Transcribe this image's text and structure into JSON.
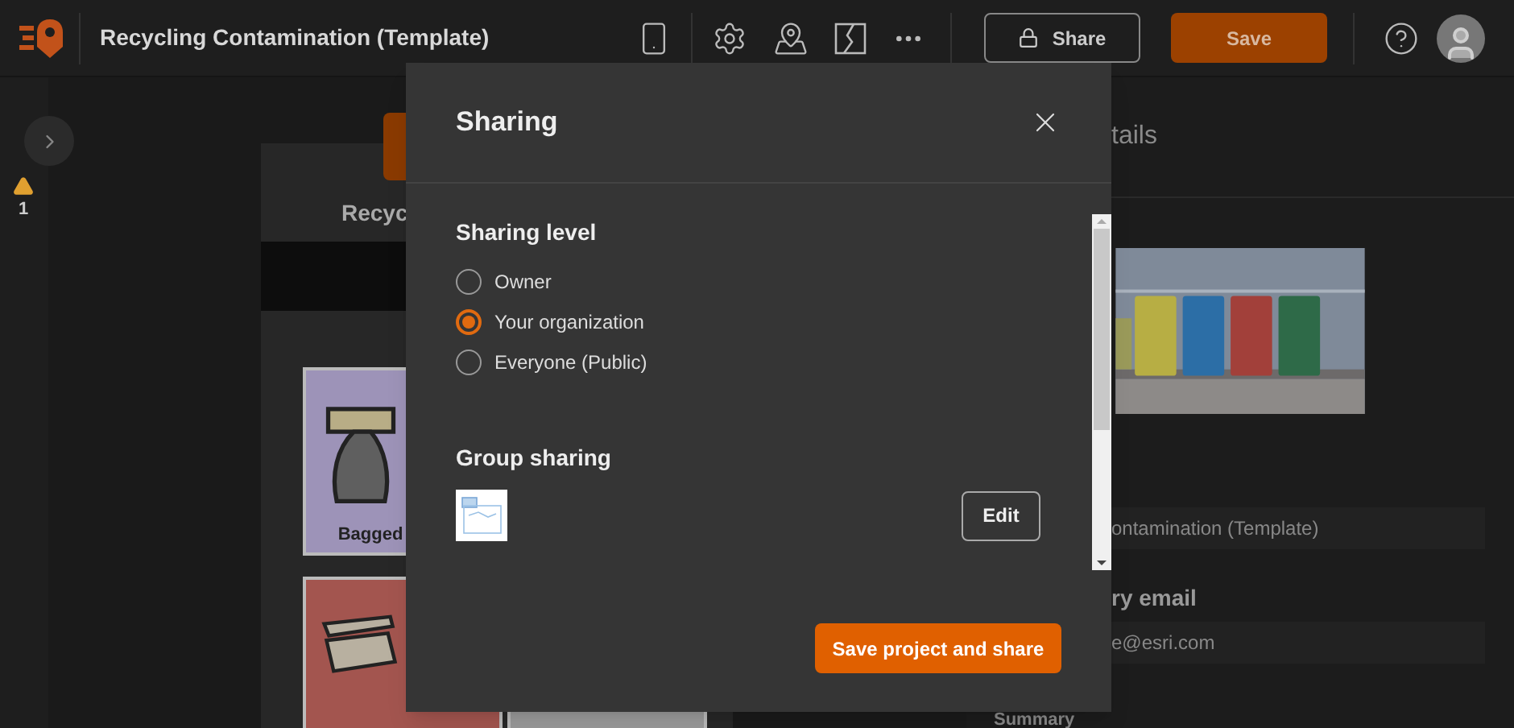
{
  "header": {
    "title": "Recycling Contamination (Template)",
    "share_button": "Share",
    "save_button": "Save"
  },
  "rail": {
    "warning_count": "1"
  },
  "preview": {
    "title": "Recyc",
    "tiles": [
      {
        "kind": "bag",
        "label": "Bagged",
        "color": "#9d93b8"
      },
      {
        "kind": "box",
        "color": "#a3554f"
      },
      {
        "kind": "plain",
        "color": "#9a9a9a"
      }
    ]
  },
  "details": {
    "heading": "tails",
    "title_field": {
      "value": "ontamination (Template)"
    },
    "email_label": "ry email",
    "email_field": {
      "value": "e@esri.com"
    },
    "summary_label": "Summary"
  },
  "dialog": {
    "title": "Sharing",
    "sharing_level": {
      "heading": "Sharing level",
      "options": [
        {
          "label": "Owner",
          "selected": false
        },
        {
          "label": "Your organization",
          "selected": true
        },
        {
          "label": "Everyone (Public)",
          "selected": false
        }
      ]
    },
    "group_sharing": {
      "heading": "Group sharing",
      "edit_button": "Edit"
    },
    "primary_button": "Save project and share"
  }
}
